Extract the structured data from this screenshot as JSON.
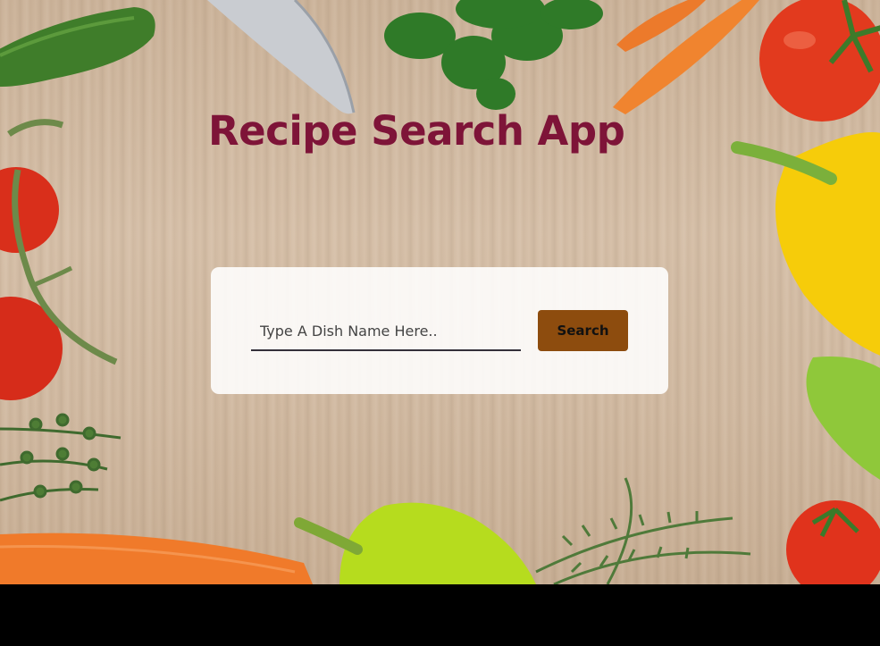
{
  "header": {
    "title": "Recipe Search App"
  },
  "search": {
    "placeholder": "Type A Dish Name Here..",
    "value": "",
    "button_label": "Search"
  },
  "colors": {
    "title": "#7e1438",
    "button": "#8d4c0e",
    "card": "#ffffff",
    "input_underline": "#34303a"
  }
}
